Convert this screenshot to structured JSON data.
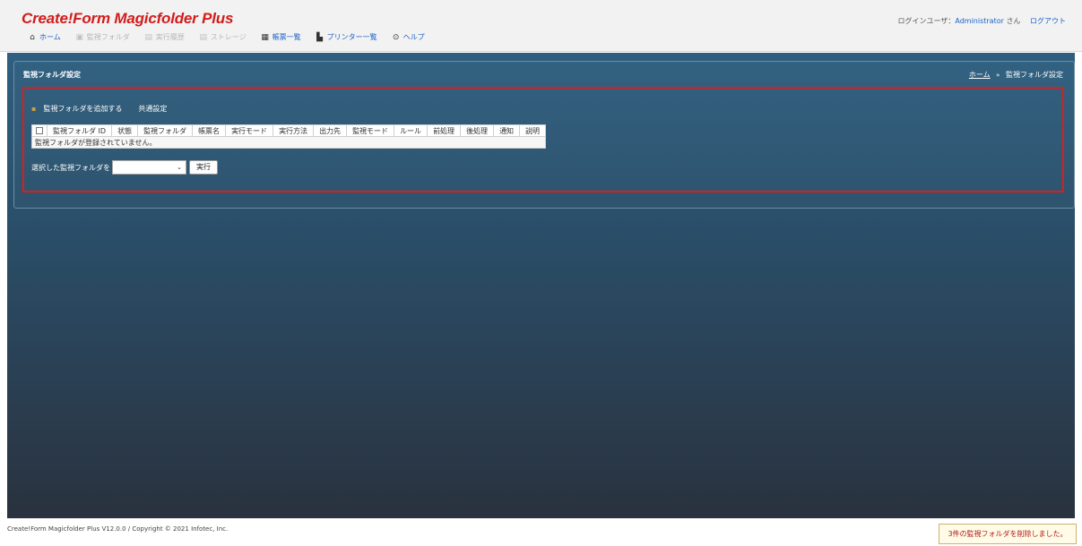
{
  "app": {
    "title": "Create!Form Magicfolder Plus"
  },
  "nav": [
    {
      "label": "ホーム",
      "icon": "home-icon",
      "enabled": true
    },
    {
      "label": "監視フォルダ",
      "icon": "folder-monitor-icon",
      "enabled": false
    },
    {
      "label": "実行履歴",
      "icon": "history-icon",
      "enabled": false
    },
    {
      "label": "ストレージ",
      "icon": "storage-icon",
      "enabled": false
    },
    {
      "label": "帳票一覧",
      "icon": "form-list-icon",
      "enabled": true
    },
    {
      "label": "プリンター一覧",
      "icon": "printer-icon",
      "enabled": true
    },
    {
      "label": "ヘルプ",
      "icon": "help-icon",
      "enabled": true
    }
  ],
  "user": {
    "prefix": "ログインユーザ：",
    "name": "Administrator",
    "suffix": "さん",
    "logout": "ログアウト"
  },
  "panel": {
    "title": "監視フォルダ設定"
  },
  "breadcrumb": {
    "home": "ホーム",
    "separator": "»",
    "current": "監視フォルダ設定"
  },
  "actions": {
    "add_folder": "監視フォルダを追加する",
    "common_settings": "共通設定"
  },
  "table": {
    "columns": [
      "監視フォルダ ID",
      "状態",
      "監視フォルダ",
      "帳票名",
      "実行モード",
      "実行方法",
      "出力先",
      "監視モード",
      "ルール",
      "前処理",
      "後処理",
      "通知",
      "説明"
    ],
    "empty_message": "監視フォルダが登録されていません。"
  },
  "bulk": {
    "label": "選択した監視フォルダを",
    "selected_value": "",
    "run_button": "実行"
  },
  "footer": {
    "copyright": "Create!Form Magicfolder Plus V12.0.0 / Copyright © 2021 Infotec, Inc."
  },
  "notice": {
    "message": "3件の監視フォルダを削除しました。"
  },
  "colors": {
    "accent": "#1a62c7",
    "brand": "#d11c1c",
    "highlight_border": "#e01b1b"
  }
}
